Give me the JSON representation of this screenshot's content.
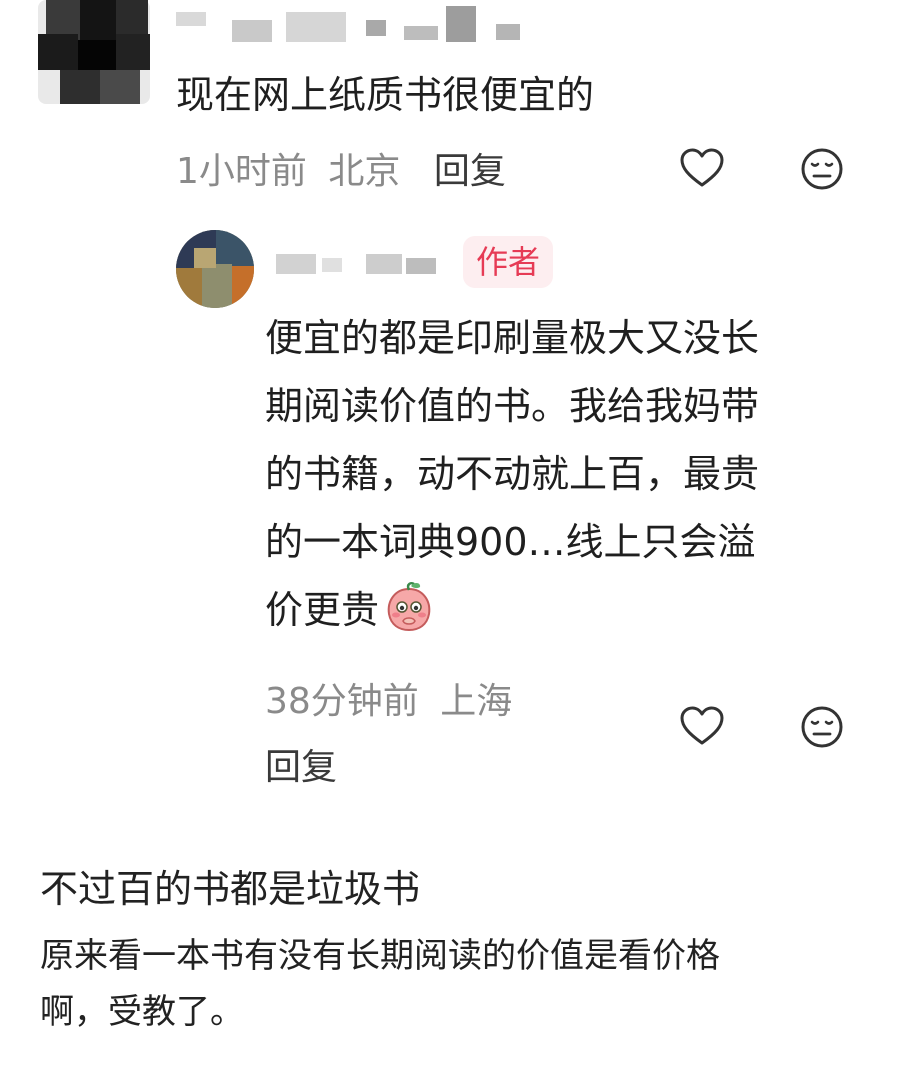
{
  "comment": {
    "text": "现在网上纸质书很便宜的",
    "time": "1小时前",
    "location": "北京",
    "reply_label": "回复",
    "like_icon": "heart-outline-icon",
    "dislike_icon": "meh-face-icon"
  },
  "reply": {
    "author_badge": "作者",
    "lines": [
      "便宜的都是印刷量极大又没长",
      "期阅读价值的书。我给我妈带",
      "的书籍，动不动就上百，最贵",
      "的一本词典900…线上只会溢",
      "价更贵"
    ],
    "emoji_icon": "peach-shy-emoji-icon",
    "time": "38分钟前",
    "location": "上海",
    "reply_label": "回复",
    "like_icon": "heart-outline-icon",
    "dislike_icon": "meh-face-icon"
  },
  "caption": {
    "title": "不过百的书都是垃圾书",
    "body_lines": [
      "原来看一本书有没有长期阅读的价值是看价格",
      "啊，受教了。"
    ]
  },
  "colors": {
    "text": "#1f1f1f",
    "meta": "#8a8a8a",
    "author_badge_bg": "#fdeef0",
    "author_badge_text": "#e63b55"
  }
}
